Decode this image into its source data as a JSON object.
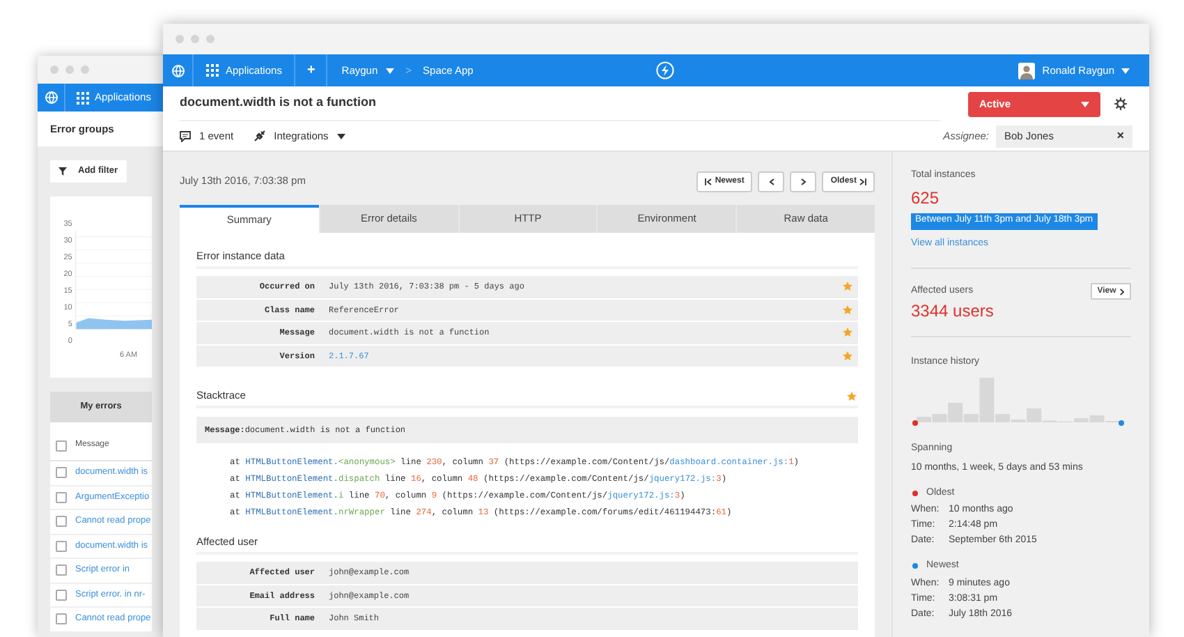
{
  "background_window": {
    "nav": {
      "label": "Applications"
    },
    "title": "Error groups",
    "add_filter": "Add filter",
    "chart": {
      "y_labels": [
        "35",
        "30",
        "25",
        "20",
        "15",
        "10",
        "5",
        "0"
      ],
      "x_label": "6 AM"
    },
    "tab": "My errors",
    "list_header": {
      "label": "Message",
      "checked": false
    },
    "rows": [
      {
        "label": "document.width is",
        "checked": false
      },
      {
        "label": "ArgumentExceptio",
        "checked": false
      },
      {
        "label": "Cannot read prope",
        "checked": false
      },
      {
        "label": "document.width is",
        "checked": false
      },
      {
        "label": "Script error in",
        "checked": false
      },
      {
        "label": "Script error. in nr-",
        "checked": false
      },
      {
        "label": "Cannot read prope",
        "checked": false
      }
    ]
  },
  "window": {
    "nav": {
      "applications": "Applications",
      "add": "+",
      "account": "Raygun",
      "separator": ">",
      "app": "Space App",
      "user": "Ronald Raygun"
    },
    "title": "document.width is not a function",
    "status": "Active",
    "events": "1 event",
    "integrations": "Integrations",
    "assignee_label": "Assignee:",
    "assignee": "Bob Jones",
    "clear": "×",
    "date": "July 13th 2016, 7:03:38 pm",
    "newest": "Newest",
    "oldest": "Oldest",
    "tabs": [
      {
        "label": "Summary",
        "selected": true
      },
      {
        "label": "Error details",
        "selected": false
      },
      {
        "label": "HTTP",
        "selected": false
      },
      {
        "label": "Environment",
        "selected": false
      },
      {
        "label": "Raw data",
        "selected": false
      }
    ],
    "instance_data": {
      "title": "Error instance data",
      "rows": [
        {
          "label": "Occurred on",
          "value": "July 13th 2016, 7:03:38 pm - 5 days ago",
          "kind": "text"
        },
        {
          "label": "Class name",
          "value": "ReferenceError",
          "kind": "text"
        },
        {
          "label": "Message",
          "value": "document.width is not a function",
          "kind": "text"
        },
        {
          "label": "Version",
          "value": "2.1.7.67",
          "kind": "link"
        }
      ]
    },
    "stacktrace": {
      "title": "Stacktrace",
      "message_label": "Message:",
      "message": "document.width is not a function",
      "frames": [
        {
          "segments": [
            {
              "kind": "text",
              "text": "at "
            },
            {
              "kind": "class",
              "text": "HTMLButtonElement."
            },
            {
              "kind": "method",
              "text": "<anonymous>"
            },
            {
              "kind": "text",
              "text": " line "
            },
            {
              "kind": "number",
              "text": "230"
            },
            {
              "kind": "text",
              "text": ", column "
            },
            {
              "kind": "number",
              "text": "37"
            },
            {
              "kind": "text",
              "text": " (https://example.com/Content/js/"
            },
            {
              "kind": "file",
              "text": "dashboard.container.js:"
            },
            {
              "kind": "number",
              "text": "1"
            },
            {
              "kind": "text",
              "text": ")"
            }
          ]
        },
        {
          "segments": [
            {
              "kind": "text",
              "text": "at "
            },
            {
              "kind": "class",
              "text": "HTMLButtonElement."
            },
            {
              "kind": "method",
              "text": "dispatch"
            },
            {
              "kind": "text",
              "text": " line "
            },
            {
              "kind": "number",
              "text": "16"
            },
            {
              "kind": "text",
              "text": ", column "
            },
            {
              "kind": "number",
              "text": "48"
            },
            {
              "kind": "text",
              "text": " (https://example.com/Content/js/"
            },
            {
              "kind": "file",
              "text": "jquery172.js:"
            },
            {
              "kind": "number",
              "text": "3"
            },
            {
              "kind": "text",
              "text": ")"
            }
          ]
        },
        {
          "segments": [
            {
              "kind": "text",
              "text": "at "
            },
            {
              "kind": "class",
              "text": "HTMLButtonElement."
            },
            {
              "kind": "method",
              "text": "i"
            },
            {
              "kind": "text",
              "text": " line "
            },
            {
              "kind": "number",
              "text": "70"
            },
            {
              "kind": "text",
              "text": ", column "
            },
            {
              "kind": "number",
              "text": "9"
            },
            {
              "kind": "text",
              "text": " (https://example.com/Content/js/"
            },
            {
              "kind": "file",
              "text": "jquery172.js:"
            },
            {
              "kind": "number",
              "text": "3"
            },
            {
              "kind": "text",
              "text": ")"
            }
          ]
        },
        {
          "segments": [
            {
              "kind": "text",
              "text": "at "
            },
            {
              "kind": "class",
              "text": "HTMLButtonElement."
            },
            {
              "kind": "method",
              "text": "nrWrapper"
            },
            {
              "kind": "text",
              "text": " line "
            },
            {
              "kind": "number",
              "text": "274"
            },
            {
              "kind": "text",
              "text": ", column "
            },
            {
              "kind": "number",
              "text": "13"
            },
            {
              "kind": "text",
              "text": " (https://example.com/forums/edit/461194473:"
            },
            {
              "kind": "number",
              "text": "61"
            },
            {
              "kind": "text",
              "text": ")"
            }
          ]
        }
      ]
    },
    "affected_user": {
      "title": "Affected user",
      "rows": [
        {
          "label": "Affected user",
          "value": "john@example.com",
          "kind": "text"
        },
        {
          "label": "Email address",
          "value": "john@example.com",
          "kind": "text"
        },
        {
          "label": "Full name",
          "value": "John Smith",
          "kind": "text"
        }
      ]
    },
    "sidebar": {
      "total_instances": {
        "label": "Total instances",
        "value": "625",
        "range": "Between July 11th 3pm and July 18th 3pm",
        "link": "View all instances"
      },
      "affected_users": {
        "label": "Affected users",
        "button": "View",
        "value": "3344 users"
      },
      "instance_history": {
        "label": "Instance history"
      },
      "spanning": {
        "label": "Spanning",
        "value": "10 months, 1 week, 5 days and 53 mins"
      },
      "ends": [
        {
          "label": "Oldest",
          "color": "#e0302a",
          "rows": [
            {
              "label": "When:",
              "value": "10 months ago"
            },
            {
              "label": "Time:",
              "value": "2:14:48 pm"
            },
            {
              "label": "Date:",
              "value": "September 6th 2015"
            }
          ]
        },
        {
          "label": "Newest",
          "color": "#1e88e5",
          "rows": [
            {
              "label": "When:",
              "value": "9 minutes ago"
            },
            {
              "label": "Time:",
              "value": "3:08:31 pm"
            },
            {
              "label": "Date:",
              "value": "July 18th 2016"
            }
          ]
        }
      ]
    }
  }
}
